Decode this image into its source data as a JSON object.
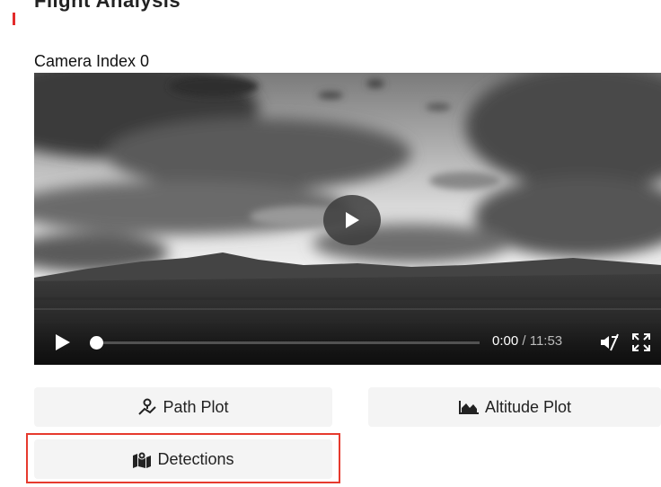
{
  "header": {
    "title": "Flight Analysis",
    "accent_color": "#e32b2b"
  },
  "camera": {
    "label": "Camera Index 0"
  },
  "video": {
    "current_time": "0:00",
    "separator": " / ",
    "duration": "11:53",
    "progress": 0,
    "play_icon": "play-icon",
    "mute_icon": "muted-speaker-icon",
    "fullscreen_icon": "fullscreen-icon"
  },
  "buttons": {
    "path_plot": {
      "label": "Path Plot",
      "icon": "path-route-icon"
    },
    "altitude_plot": {
      "label": "Altitude Plot",
      "icon": "area-chart-icon"
    },
    "detections": {
      "label": "Detections",
      "icon": "map-marker-icon"
    }
  },
  "highlight": {
    "target": "detections",
    "color": "#e63a2e"
  }
}
